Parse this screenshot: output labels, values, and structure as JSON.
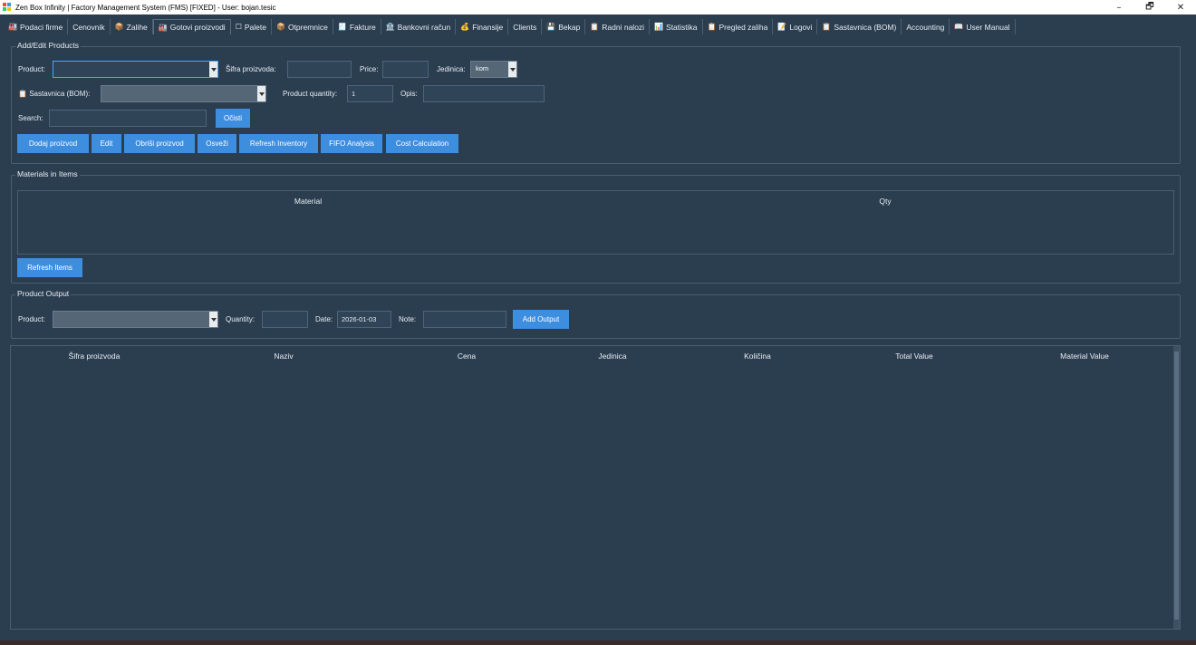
{
  "window": {
    "title": "Zen Box Infinity | Factory Management System (FMS) [FIXED] - User: bojan.tesic",
    "min_label": "–",
    "max_label": "🗗",
    "close_label": "✕"
  },
  "tabs": [
    {
      "icon": "🏭",
      "label": "Podaci firme"
    },
    {
      "icon": "",
      "label": "Cenovnik"
    },
    {
      "icon": "📦",
      "label": "Zalihe"
    },
    {
      "icon": "🏭",
      "label": "Gotovi proizvodi"
    },
    {
      "icon": "☐",
      "label": "Palete"
    },
    {
      "icon": "📦",
      "label": "Otpremnice"
    },
    {
      "icon": "🧾",
      "label": "Fakture"
    },
    {
      "icon": "🏦",
      "label": "Bankovni račun"
    },
    {
      "icon": "💰",
      "label": "Finansije"
    },
    {
      "icon": "",
      "label": "Clients"
    },
    {
      "icon": "💾",
      "label": "Bekap"
    },
    {
      "icon": "📋",
      "label": "Radni nalozi"
    },
    {
      "icon": "📊",
      "label": "Statistika"
    },
    {
      "icon": "📋",
      "label": "Pregled zaliha"
    },
    {
      "icon": "📝",
      "label": "Logovi"
    },
    {
      "icon": "📋",
      "label": "Sastavnica (BOM)"
    },
    {
      "icon": "",
      "label": "Accounting"
    },
    {
      "icon": "📖",
      "label": "User Manual"
    }
  ],
  "add_edit": {
    "title": "Add/Edit Products",
    "product_label": "Product:",
    "product_value": "",
    "sifra_label": "Šifra proizvoda:",
    "sifra_value": "",
    "price_label": "Price:",
    "price_value": "",
    "jedinica_label": "Jedinica:",
    "jedinica_value": "kom",
    "bom_icon": "📋",
    "bom_label": "Sastavnica (BOM):",
    "bom_value": "",
    "quantity_label": "Product quantity:",
    "quantity_value": "1",
    "opis_label": "Opis:",
    "opis_value": "",
    "search_label": "Search:",
    "search_value": "",
    "clear_button": "Očisti",
    "buttons": [
      "Dodaj proizvod",
      "Edit",
      "Obriši proizvod",
      "Osveži",
      "Refresh Inventory",
      "FIFO Analysis",
      "Cost Calculation"
    ]
  },
  "materials": {
    "title": "Materials in Items",
    "columns": [
      "Material",
      "Qty"
    ],
    "rows": [],
    "refresh_button": "Refresh Items"
  },
  "output": {
    "title": "Product Output",
    "product_label": "Product:",
    "product_value": "",
    "quantity_label": "Quantity:",
    "quantity_value": "",
    "date_label": "Date:",
    "date_value": "2026-01-03",
    "note_label": "Note:",
    "note_value": "",
    "add_button": "Add Output"
  },
  "products_table": {
    "columns": [
      "Šifra proizvoda",
      "Naziv",
      "Cena",
      "Jedinica",
      "Količina",
      "Total Value",
      "Material Value"
    ],
    "rows": []
  }
}
